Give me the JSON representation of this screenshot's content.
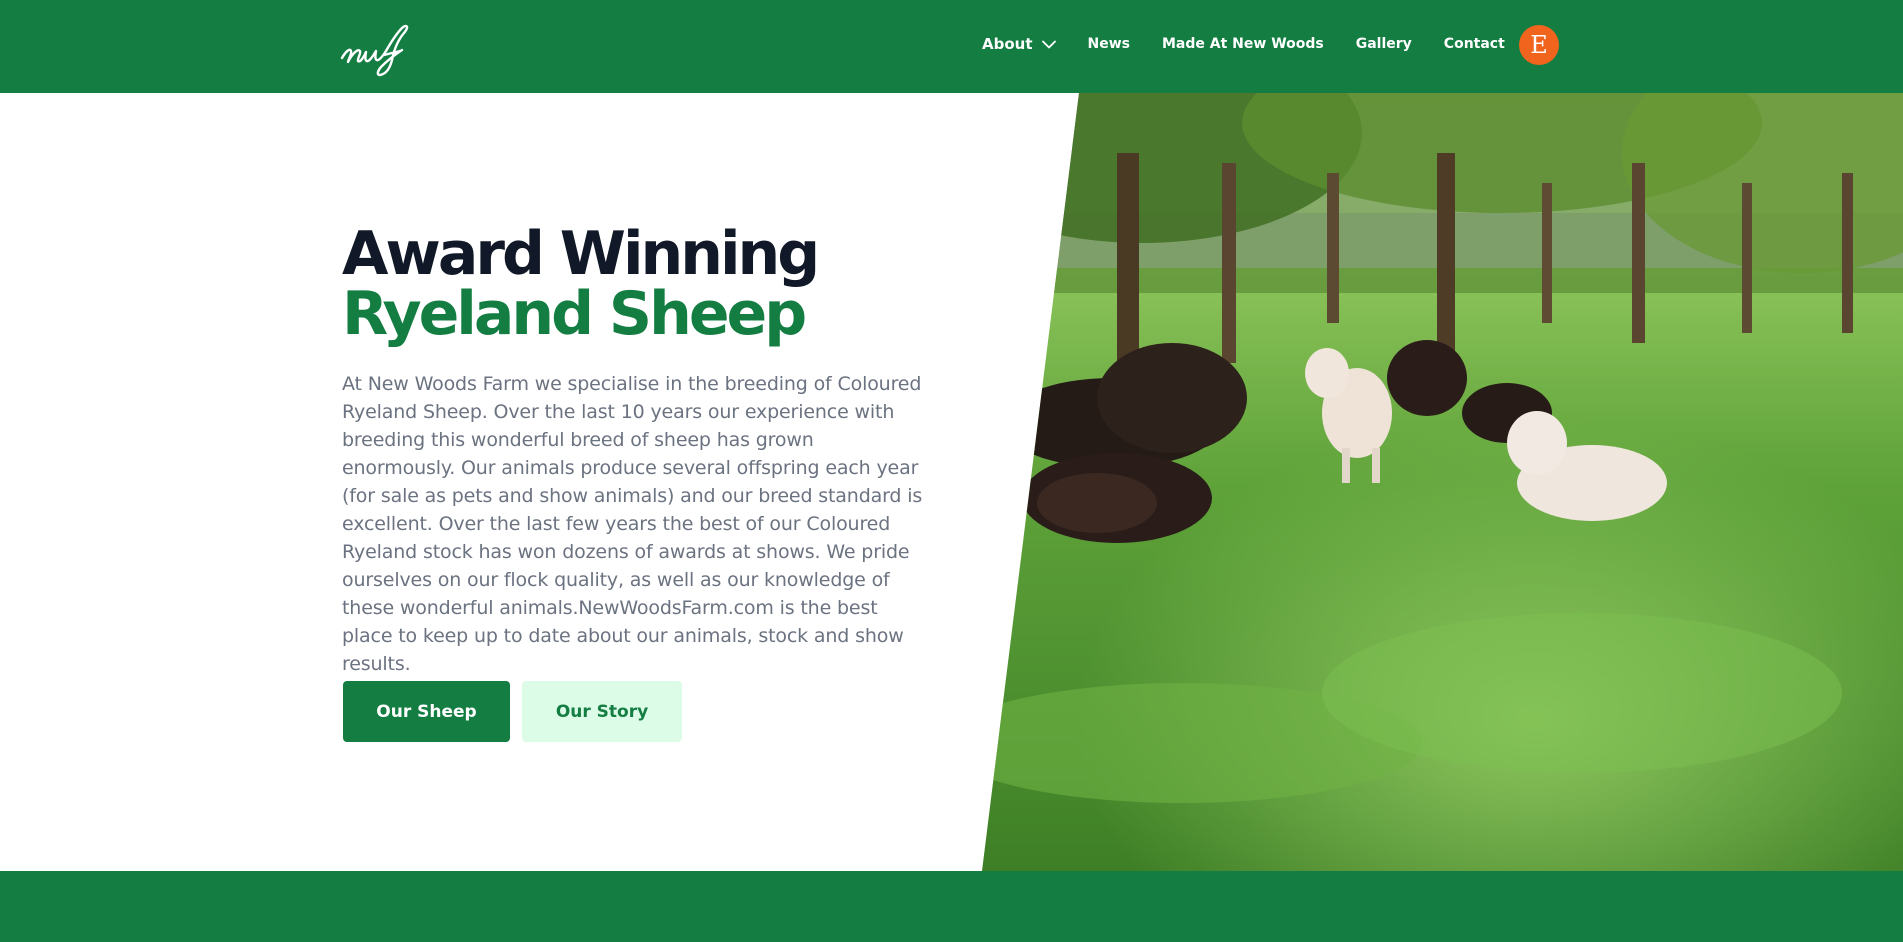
{
  "header": {
    "logo_text": "nwf",
    "nav": {
      "about": "About",
      "news": "News",
      "made": "Made At New Woods",
      "gallery": "Gallery",
      "contact": "Contact"
    },
    "etsy_letter": "E",
    "etsy_icon": "etsy-icon",
    "dropdown_icon": "chevron-down-icon"
  },
  "hero": {
    "title_line1": "Award Winning",
    "title_line2": "Ryeland Sheep",
    "description": "At New Woods Farm we specialise in the breeding of Coloured Ryeland Sheep. Over the last 10 years our experience with breeding this wonderful breed of sheep has grown enormously. Our animals produce several offspring each year (for sale as pets and show animals) and our breed standard is excellent. Over the last few years the best of our Coloured Ryeland stock has won dozens of awards at shows. We pride ourselves on our flock quality, as well as our knowledge of these wonderful animals.NewWoodsFarm.com is the best place to keep up to date about our animals, stock and show results.",
    "buttons": {
      "primary": "Our Sheep",
      "secondary": "Our Story"
    }
  },
  "colors": {
    "brand_green": "#137d42",
    "button_secondary_bg": "#dcfce7",
    "title_dark": "#111827",
    "body_text": "#6b7280",
    "etsy_orange": "#f1641e"
  }
}
